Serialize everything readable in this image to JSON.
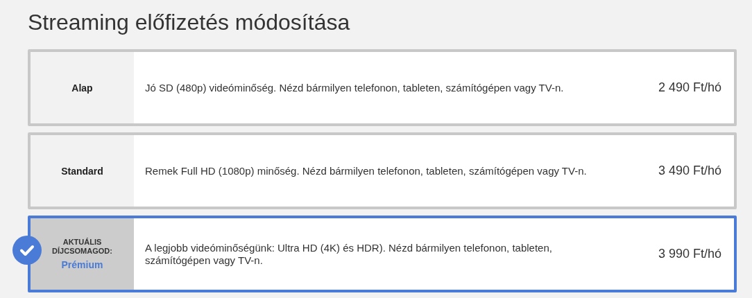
{
  "title": "Streaming előfizetés módosítása",
  "plans": [
    {
      "name": "Alap",
      "description": "Jó SD (480p) videóminőség. Nézd bármilyen telefonon, tableten, számítógépen vagy TV-n.",
      "price": "2 490 Ft/hó",
      "selected": false
    },
    {
      "name": "Standard",
      "description": "Remek Full HD (1080p) minőség. Nézd bármilyen telefonon, tableten, számítógépen vagy TV-n.",
      "price": "3 490 Ft/hó",
      "selected": false
    },
    {
      "name": "Prémium",
      "current_label": "AKTUÁLIS DÍJCSOMAGOD:",
      "description": "A legjobb videóminőségünk: Ultra HD (4K) és HDR). Nézd bármilyen telefonon, tableten, számítógépen vagy TV-n.",
      "price": "3 990 Ft/hó",
      "selected": true
    }
  ]
}
